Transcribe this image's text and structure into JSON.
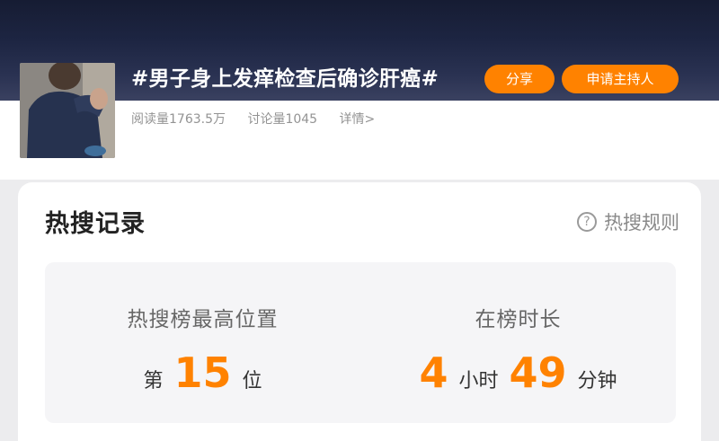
{
  "header": {
    "topic_title": "#男子身上发痒检查后确诊肝癌#",
    "share_label": "分享",
    "host_label": "申请主持人",
    "read_count": "阅读量1763.5万",
    "discussion_count": "讨论量1045",
    "details_link": "详情>"
  },
  "card": {
    "title": "热搜记录",
    "rules_label": "热搜规则",
    "rules_icon": "?",
    "highest_rank": {
      "label": "热搜榜最高位置",
      "prefix": "第",
      "value": "15",
      "suffix": "位"
    },
    "duration": {
      "label": "在榜时长",
      "hours": "4",
      "hours_unit": "小时",
      "minutes": "49",
      "minutes_unit": "分钟"
    }
  },
  "colors": {
    "accent": "#ff8200",
    "header_dark": "#1d2542"
  }
}
